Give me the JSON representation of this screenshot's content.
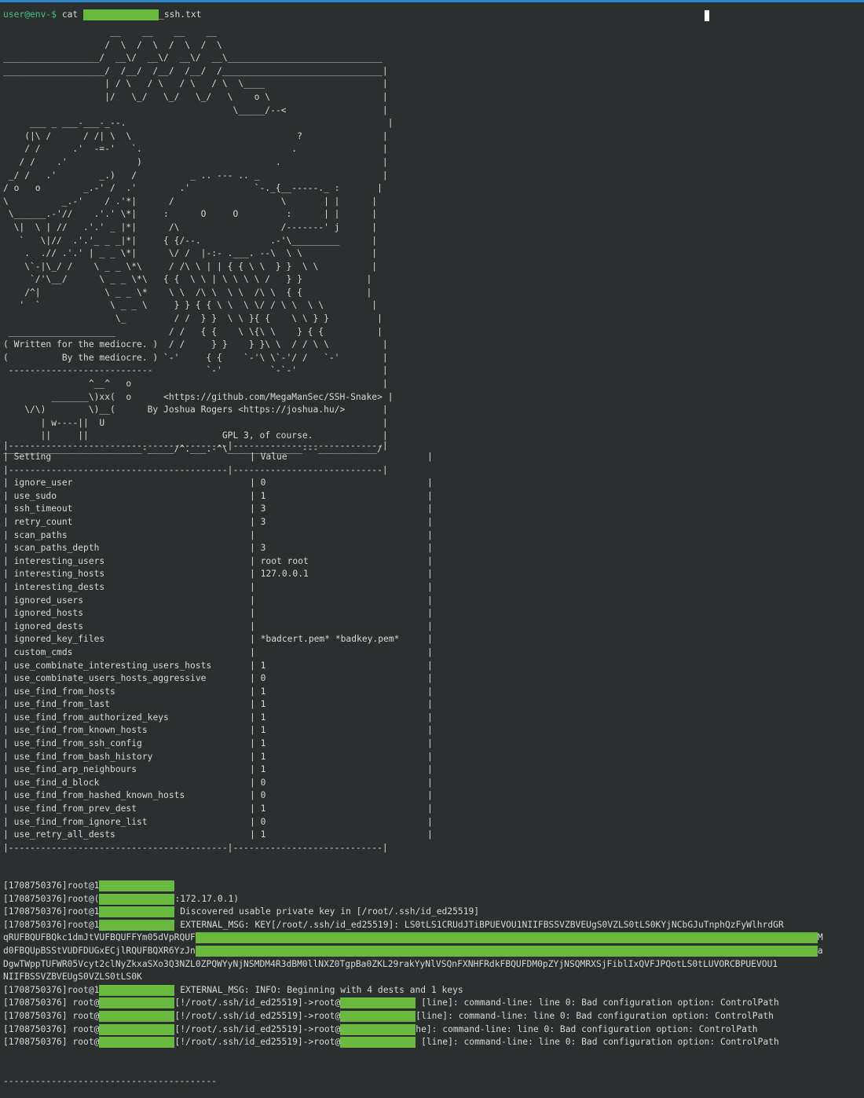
{
  "terminal": {
    "prompt": "user@env-$",
    "command_prefix": "cat ",
    "command_suffix": "_ssh.txt"
  },
  "banner_art": "                    __    __    __    __\n                   /  \\  /  \\  /  \\  /  \\\n__________________/  __\\/  __\\/  __\\/  __\\_____________________________\n___________________/  /__/  /__/  /__/  /______________________________|\n                   | / \\   / \\   / \\   / \\  \\____                      |\n                   |/   \\_/   \\_/   \\_/   \\    o \\                     |\n                                           \\_____/--<                  |\n     ___ _ ___-___-_--.                                                 |\n    (|\\ /      / /| \\  \\                               ?               |\n    / /      .'  -=-'   `.                            .                |\n   / /    .'             )                         .                   |\n _/ /   .'        _.)   /          _ .. --- .. _                       |\n/ o   o        _.-' /  .'        .'            `-._{__-----._ :       |\n\\          _.-'    / .'*|      /                    \\       | |      |\n \\______.-'//    .'.' \\*|     :      O     O         :      | |      |\n  \\|  \\ | //   .'.' _ |*|      /\\                   /-------' j      |\n   `   \\|//  .'.'_ _ _|*|     { {/--.             .-'\\_________      |\n    .  .// .'.' | _ _ \\*|      \\/ /  |-:- .___. --\\  \\ \\             |\n    \\`-|\\_/ /    \\ _ _ \\*\\     / /\\ \\ | | { { \\ \\  } }  \\ \\          |\n     `/'\\__/      \\ _ _ \\*\\   { {  \\ \\ | \\ \\ \\ \\ /   } }            |\n    /^|            \\ _ _ \\*    \\ \\  /\\ \\  \\ \\  /\\ \\  { {            |\n   '  `             \\ _ _ \\     } } { { \\ \\  \\ \\/ / \\ \\  \\ \\         |\n                     \\_         / /  } }  \\ \\ }{ {    \\ \\ } }         |\n ____________________          / /   { {    \\ \\{\\ \\    } { {          |\n( Written for the mediocre. )  / /     } }    } }\\ \\  / / \\ \\          |\n(          By the mediocre. ) `-'     { {    `-'\\ \\`-'/ /   `-'        |\n ---------------------------          `-'         `-`-'                |\n                ^__^   o                                               |\n         _______\\)xx(  o      <https://github.com/MegaManSec/SSH-Snake> |\n    \\/\\)        \\)__(      By Joshua Rogers <https://joshua.hu/>       |\n       | w----||  U                                                    |\n       ||     ||                         GPL 3, of course.             |\n__________________________-_____/^.___.-^\\______________---___________/",
  "settings_table": {
    "headers": [
      "Setting",
      "Value"
    ],
    "rows": [
      [
        "ignore_user",
        "0"
      ],
      [
        "use_sudo",
        "1"
      ],
      [
        "ssh_timeout",
        "3"
      ],
      [
        "retry_count",
        "3"
      ],
      [
        "scan_paths",
        ""
      ],
      [
        "scan_paths_depth",
        "3"
      ],
      [
        "interesting_users",
        "root root"
      ],
      [
        "interesting_hosts",
        "127.0.0.1"
      ],
      [
        "interesting_dests",
        ""
      ],
      [
        "ignored_users",
        ""
      ],
      [
        "ignored_hosts",
        ""
      ],
      [
        "ignored_dests",
        ""
      ],
      [
        "ignored_key_files",
        "*badcert.pem* *badkey.pem*"
      ],
      [
        "custom_cmds",
        ""
      ],
      [
        "use_combinate_interesting_users_hosts",
        "1"
      ],
      [
        "use_combinate_users_hosts_aggressive",
        "0"
      ],
      [
        "use_find_from_hosts",
        "1"
      ],
      [
        "use_find_from_last",
        "1"
      ],
      [
        "use_find_from_authorized_keys",
        "1"
      ],
      [
        "use_find_from_known_hosts",
        "1"
      ],
      [
        "use_find_from_ssh_config",
        "1"
      ],
      [
        "use_find_from_bash_history",
        "1"
      ],
      [
        "use_find_arp_neighbours",
        "1"
      ],
      [
        "use_find_d_block",
        "0"
      ],
      [
        "use_find_from_hashed_known_hosts",
        "0"
      ],
      [
        "use_find_from_prev_dest",
        "1"
      ],
      [
        "use_find_from_ignore_list",
        "0"
      ],
      [
        "use_retry_all_dests",
        "1"
      ]
    ]
  },
  "log": {
    "timestamp": "[1708750376]",
    "line1_prefix": "root@1",
    "line2_prefix": "root@(",
    "line2_suffix": ":172.17.0.1)",
    "line3_prefix": "root@1",
    "line3_msg": " Discovered usable private key in [/root/.ssh/id_ed25519]",
    "line4_prefix": "root@1",
    "line4_msg": " EXTERNAL_MSG: KEY[/root/.ssh/id_ed25519]: LS0tLS1CRUdJTiBPUEVOU1NIIFBSSVZBVEUgS0VZLS0tLS0KYjNCbGJuTnphQzFyWlhrdGR",
    "key_line2_start": "qRUFBQUFBQkc1dmJtVUFBQUFFYm05dVpRQUF",
    "key_line2_end": "M",
    "key_line3_start": "d0FBQUpBSStVUDFDUGxECjlRQUFBQXR6YzJn",
    "key_line3_end": "a",
    "key_line4": "DgwTWppTUFWR05Vcyt2clNyZkxaSXo3Q3NZL0ZPQWYyNjNSMDM4R3dBM0llNXZ0TgpBa0ZKL29rakYyNlVSQnFXNHFRdkFBQUFDM0pZYjNSQMRXSjFiblIxQVFJPQotLS0tLUVORCBPUEVOU1",
    "key_line5": "NIIFBSSVZBVEUgS0VZLS0tLS0K",
    "line9_prefix": "root@1",
    "line9_msg": " EXTERNAL_MSG: INFO: Beginning with 4 dests and 1 keys",
    "conn_prefix": " root@",
    "conn_mid": "[!/root/.ssh/id_ed25519]->root@",
    "conn_tail_a": " [line]: command-line: line 0: Bad configuration option: ControlPath",
    "conn_tail_b": "[line]: command-line: line 0: Bad configuration option: ControlPath",
    "conn_tail_c": "he]: command-line: line 0: Bad configuration option: ControlPath"
  },
  "bottom_rule": "----------------------------------------"
}
